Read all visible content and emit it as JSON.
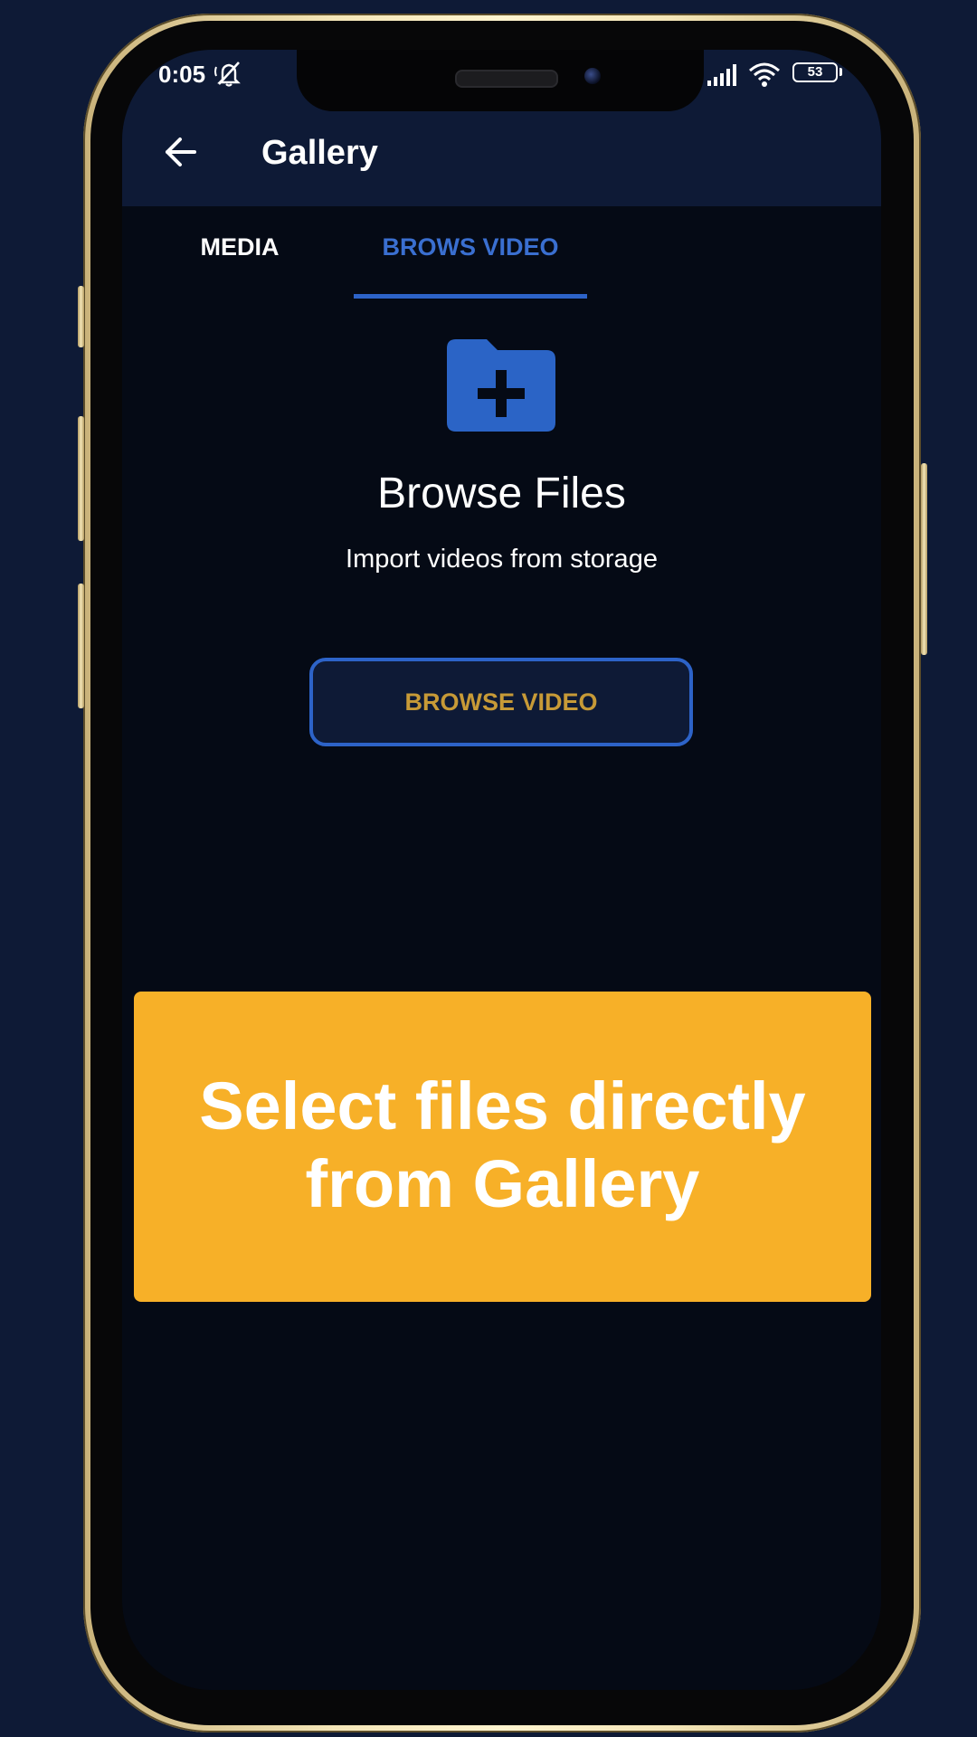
{
  "status_bar": {
    "time": "0:05",
    "battery": "53",
    "icons": [
      "mute-icon",
      "signal-icon",
      "wifi-icon",
      "battery-icon"
    ]
  },
  "app_bar": {
    "title": "Gallery",
    "back_icon": "arrow-left-icon"
  },
  "tabs": [
    {
      "label": "MEDIA",
      "selected": false
    },
    {
      "label": "BROWS VIDEO",
      "selected": true
    }
  ],
  "content": {
    "icon": "folder-plus-icon",
    "title": "Browse Files",
    "subtitle": "Import videos from storage",
    "button_label": "BROWSE VIDEO"
  },
  "banner": {
    "line1": "Select files directly",
    "line2": "from Gallery"
  },
  "colors": {
    "background": "#0e1a36",
    "screen": "#050a15",
    "accent_blue": "#2d63c8",
    "button_text": "#c79a37",
    "banner": "#f7b028",
    "frame_gold": "#f4e6b8"
  }
}
